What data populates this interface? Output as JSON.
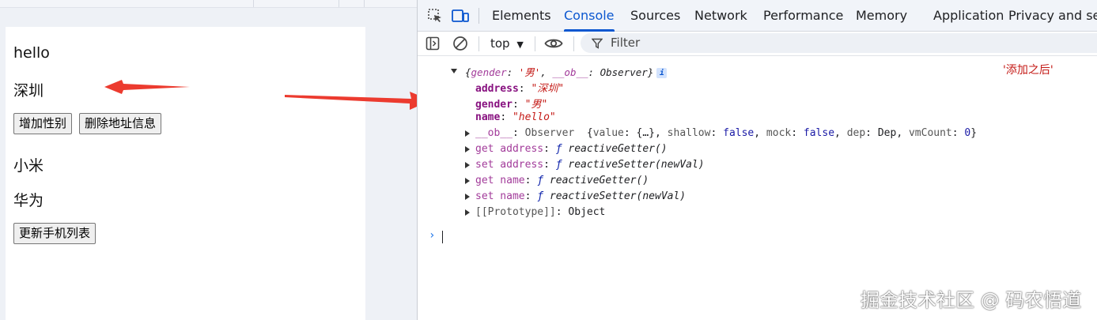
{
  "app": {
    "message": "hello",
    "address": "深圳",
    "add_gender_button": "增加性别",
    "delete_address_button": "删除地址信息",
    "phones": [
      "小米",
      "华为"
    ],
    "update_phones_button": "更新手机列表"
  },
  "devtools": {
    "tabs": [
      "Elements",
      "Console",
      "Sources",
      "Network",
      "Performance",
      "Memory",
      "Application",
      "Privacy and secu"
    ],
    "active_tab": "Console",
    "accent_color": "#0b57d0",
    "toolbar": {
      "context": "top",
      "filter_placeholder": "Filter",
      "icons": [
        "sidebar-toggle-icon",
        "clear-console-icon",
        "eye-icon",
        "filter-icon"
      ]
    },
    "console": {
      "log_label": "'添加之后'",
      "object_preview": {
        "open": "{",
        "k1": "gender",
        "sep1": ": ",
        "v1": "'男'",
        "comma": ", ",
        "k2": "__ob__",
        "sep2": ": ",
        "v2": "Observer",
        "close": "}"
      },
      "info_badge": "i",
      "properties": [
        {
          "key": "address",
          "value": "\"深圳\""
        },
        {
          "key": "gender",
          "value": "\"男\""
        },
        {
          "key": "name",
          "value": "\"hello\""
        }
      ],
      "ob_row": {
        "key": "__ob__",
        "type": "Observer",
        "preview": {
          "k_value": "value",
          "v_value": "{…}",
          "k_shallow": "shallow",
          "v_shallow": "false",
          "k_mock": "mock",
          "v_mock": "false",
          "k_dep": "dep",
          "v_dep": "Dep",
          "k_vmcount": "vmCount",
          "v_vmcount": "0"
        }
      },
      "accessors": [
        {
          "key": "get address",
          "fn": "reactiveGetter()"
        },
        {
          "key": "set address",
          "fn": "reactiveSetter(newVal)"
        },
        {
          "key": "get name",
          "fn": "reactiveGetter()"
        },
        {
          "key": "set name",
          "fn": "reactiveSetter(newVal)"
        }
      ],
      "prototype": {
        "key": "[[Prototype]]",
        "value": "Object"
      },
      "f_symbol": "ƒ",
      "prompt": "›"
    }
  },
  "watermark": "掘金技术社区 @ 码农悟道",
  "colors": {
    "annotation_arrow": "#ec3b2f"
  }
}
